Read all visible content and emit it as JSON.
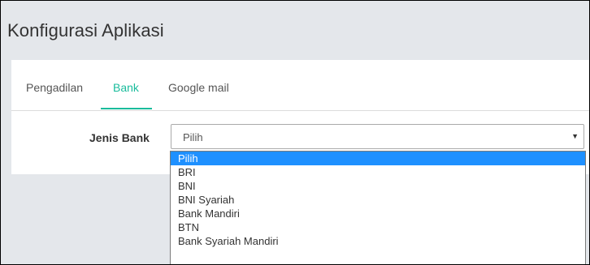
{
  "page": {
    "title": "Konfigurasi Aplikasi"
  },
  "tabs": [
    {
      "label": "Pengadilan",
      "active": false
    },
    {
      "label": "Bank",
      "active": true
    },
    {
      "label": "Google mail",
      "active": false
    }
  ],
  "form": {
    "bank_type_label": "Jenis Bank",
    "bank_type_value": "Pilih",
    "bank_type_options": [
      "Pilih",
      "BRI",
      "BNI",
      "BNI Syariah",
      "Bank Mandiri",
      "BTN",
      "Bank Syariah Mandiri"
    ],
    "highlighted_option": "Pilih"
  },
  "icons": {
    "select_arrow": "chevron-down-icon"
  },
  "colors": {
    "accent": "#1abc9c",
    "highlight": "#1e90ff",
    "background": "#e4e7eb"
  }
}
